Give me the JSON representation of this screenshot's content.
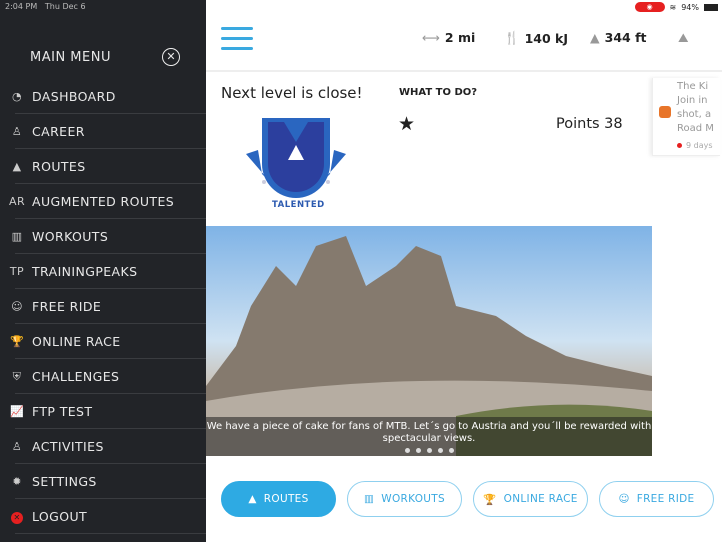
{
  "status": {
    "time": "2:04 PM",
    "date": "Thu Dec 6",
    "battery": "94%"
  },
  "sidebar": {
    "title": "MAIN MENU",
    "items": [
      {
        "label": "DASHBOARD",
        "icon": "dashboard-icon",
        "glyph": "◔"
      },
      {
        "label": "CAREER",
        "icon": "user-icon",
        "glyph": "♙"
      },
      {
        "label": "ROUTES",
        "icon": "mountain-icon",
        "glyph": "▲"
      },
      {
        "label": "AUGMENTED ROUTES",
        "icon": "ar-icon",
        "glyph": "AR"
      },
      {
        "label": "WORKOUTS",
        "icon": "bar-chart-icon",
        "glyph": "▥"
      },
      {
        "label": "TRAININGPEAKS",
        "icon": "trainingpeaks-icon",
        "glyph": "TP"
      },
      {
        "label": "FREE RIDE",
        "icon": "smiley-icon",
        "glyph": "☺"
      },
      {
        "label": "ONLINE RACE",
        "icon": "trophy-icon",
        "glyph": "🏆"
      },
      {
        "label": "CHALLENGES",
        "icon": "shield-star-icon",
        "glyph": "⛨"
      },
      {
        "label": "FTP TEST",
        "icon": "line-chart-icon",
        "glyph": "📈"
      },
      {
        "label": "ACTIVITIES",
        "icon": "users-icon",
        "glyph": "♙"
      },
      {
        "label": "SETTINGS",
        "icon": "gear-icon",
        "glyph": "✹"
      },
      {
        "label": "LOGOUT",
        "icon": "logout-icon",
        "glyph": "✕"
      }
    ]
  },
  "stats": {
    "distance": "2 mi",
    "energy": "140 kJ",
    "elevation": "344 ft"
  },
  "level": {
    "heading": "Next level is close!",
    "badge": "TALENTED",
    "what_to_do": "WHAT TO DO?",
    "points": "Points 38"
  },
  "feed": {
    "lines": [
      "The Ki",
      "Join in",
      "shot, a",
      "Road M"
    ],
    "date": "9 days"
  },
  "hero": {
    "caption": "We have a piece of cake for fans of MTB. Let´s go to Austria and you´ll be rewarded with spectacular views."
  },
  "buttons": [
    {
      "label": "ROUTES",
      "glyph": "▲"
    },
    {
      "label": "WORKOUTS",
      "glyph": "▥"
    },
    {
      "label": "ONLINE RACE",
      "glyph": "🏆"
    },
    {
      "label": "FREE RIDE",
      "glyph": "☺"
    }
  ],
  "colors": {
    "accent": "#2eaae3",
    "sidebar": "#222428",
    "logout": "#e62020",
    "badge": "#2c4a9e"
  }
}
